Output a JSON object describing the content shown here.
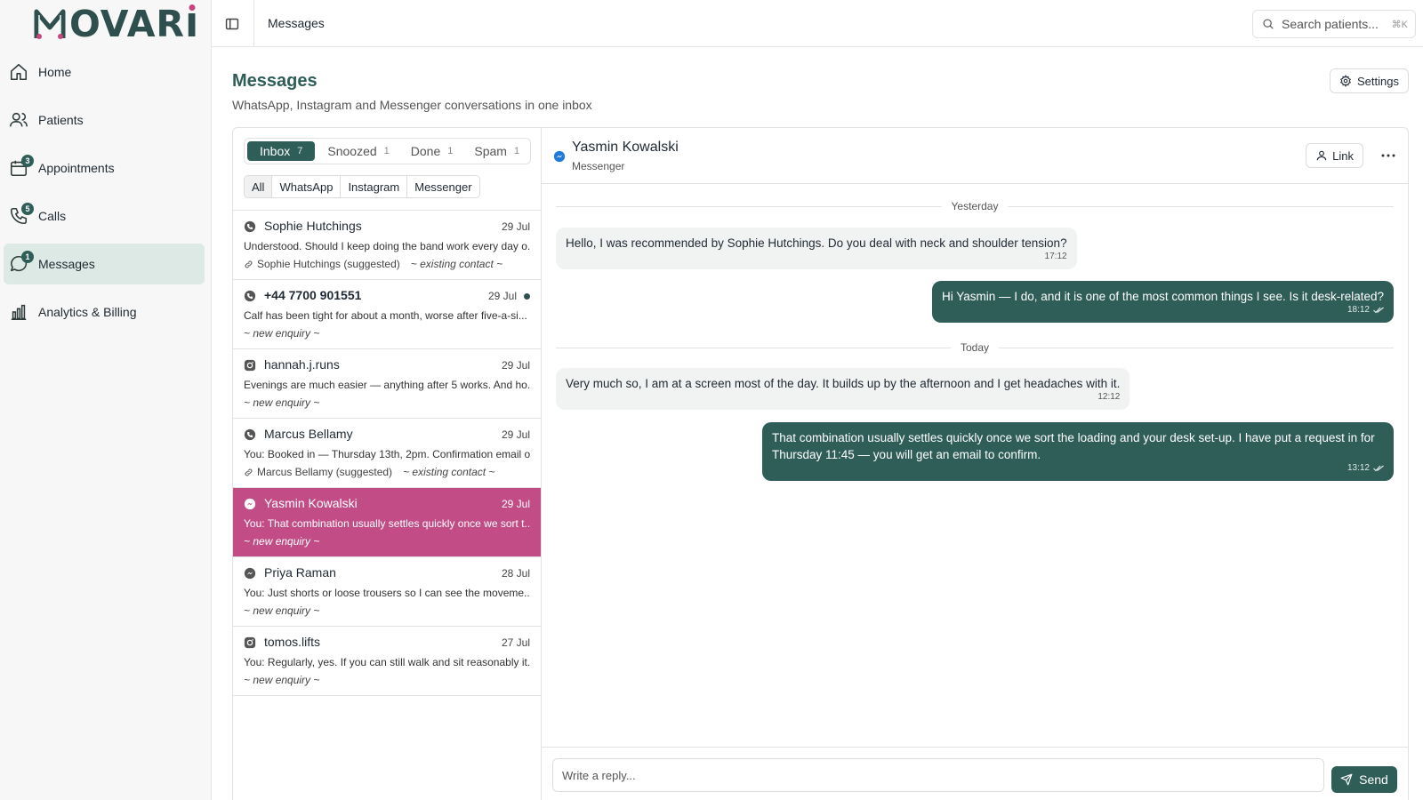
{
  "app": {
    "logo_text": "MOVARI",
    "logo_suffix": "OVAR"
  },
  "nav": {
    "items": [
      {
        "label": "Home",
        "icon": "home-icon"
      },
      {
        "label": "Patients",
        "icon": "users-icon"
      },
      {
        "label": "Appointments",
        "icon": "calendar-icon",
        "badge": "3"
      },
      {
        "label": "Calls",
        "icon": "phone-icon",
        "badge": "5"
      },
      {
        "label": "Messages",
        "icon": "chat-bubble-icon",
        "badge": "1",
        "active": true
      },
      {
        "label": "Analytics & Billing",
        "icon": "bar-chart-icon"
      }
    ]
  },
  "topbar": {
    "title": "Messages",
    "search_placeholder": "Search patients...",
    "search_shortcut": "⌘K"
  },
  "page": {
    "title": "Messages",
    "subtitle": "WhatsApp, Instagram and Messenger conversations in one inbox",
    "settings_label": "Settings"
  },
  "status_tabs": [
    {
      "label": "Inbox",
      "count": "7",
      "active": true
    },
    {
      "label": "Snoozed",
      "count": "1"
    },
    {
      "label": "Done",
      "count": "1"
    },
    {
      "label": "Spam",
      "count": "1"
    }
  ],
  "channel_tabs": [
    {
      "label": "All",
      "active": true
    },
    {
      "label": "WhatsApp"
    },
    {
      "label": "Instagram"
    },
    {
      "label": "Messenger"
    }
  ],
  "conversations": [
    {
      "name": "Sophie Hutchings",
      "date": "29 Jul",
      "channel": "whatsapp",
      "preview": "Understood. Should I keep doing the band work every day o...",
      "link": "Sophie Hutchings (suggested)",
      "tag": "~ existing contact ~"
    },
    {
      "name": "+44 7700 901551",
      "date": "29 Jul",
      "channel": "whatsapp",
      "unread": true,
      "preview": "Calf has been tight for about a month, worse after five-a-si...",
      "tag": "~ new enquiry ~"
    },
    {
      "name": "hannah.j.runs",
      "date": "29 Jul",
      "channel": "instagram",
      "preview": "Evenings are much easier — anything after 5 works. And ho...",
      "tag": "~ new enquiry ~"
    },
    {
      "name": "Marcus Bellamy",
      "date": "29 Jul",
      "channel": "whatsapp",
      "preview": "You: Booked in — Thursday 13th, 2pm. Confirmation email o...",
      "link": "Marcus Bellamy (suggested)",
      "tag": "~ existing contact ~"
    },
    {
      "name": "Yasmin Kowalski",
      "date": "29 Jul",
      "channel": "messenger",
      "active": true,
      "preview": "You: That combination usually settles quickly once we sort t...",
      "tag": "~ new enquiry ~"
    },
    {
      "name": "Priya Raman",
      "date": "28 Jul",
      "channel": "messenger",
      "preview": "You: Just shorts or loose trousers so I can see the moveme...",
      "tag": "~ new enquiry ~"
    },
    {
      "name": "tomos.lifts",
      "date": "27 Jul",
      "channel": "instagram",
      "preview": "You: Regularly, yes. If you can still walk and sit reasonably it...",
      "tag": "~ new enquiry ~"
    }
  ],
  "chat": {
    "name": "Yasmin Kowalski",
    "channel": "Messenger",
    "link_label": "Link",
    "more_label": "···",
    "days": [
      "Yesterday",
      "Today"
    ],
    "messages": [
      {
        "direction": "in",
        "text": "Hello, I was recommended by Sophie Hutchings. Do you deal with neck and shoulder tension?",
        "time": "17:12"
      },
      {
        "direction": "out",
        "text": "Hi Yasmin — I do, and it is one of the most common things I see. Is it desk-related?",
        "time": "18:12"
      },
      {
        "direction": "in",
        "text": "Very much so, I am at a screen most of the day. It builds up by the afternoon and I get headaches with it.",
        "time": "12:12"
      },
      {
        "direction": "out",
        "text": "That combination usually settles quickly once we sort the loading and your desk set-up. I have put a request in for Thursday 11:45 — you will get an email to confirm.",
        "time": "13:12"
      }
    ],
    "reply_placeholder": "Write a reply...",
    "send_label": "Send"
  },
  "colors": {
    "brand": "#2f5d58",
    "accent_pink": "#c24d86",
    "sidebar_active": "#dde9e4"
  }
}
